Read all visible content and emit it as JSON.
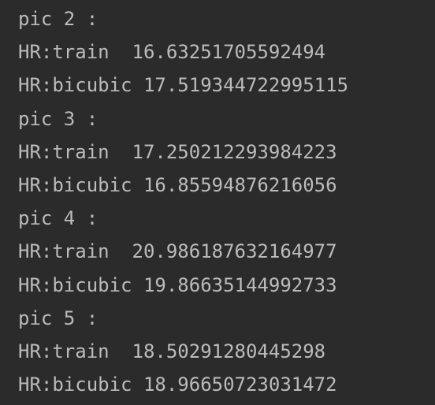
{
  "console": {
    "lines": [
      "pic 2 :",
      "HR:train  16.63251705592494",
      "HR:bicubic 17.519344722995115",
      "pic 3 :",
      "HR:train  17.250212293984223",
      "HR:bicubic 16.85594876216056",
      "pic 4 :",
      "HR:train  20.986187632164977",
      "HR:bicubic 19.86635144992733",
      "pic 5 :",
      "HR:train  18.50291280445298",
      "HR:bicubic 18.96650723031472"
    ]
  },
  "colors": {
    "background": "#2b2b2b",
    "text": "#bbbbbb"
  }
}
